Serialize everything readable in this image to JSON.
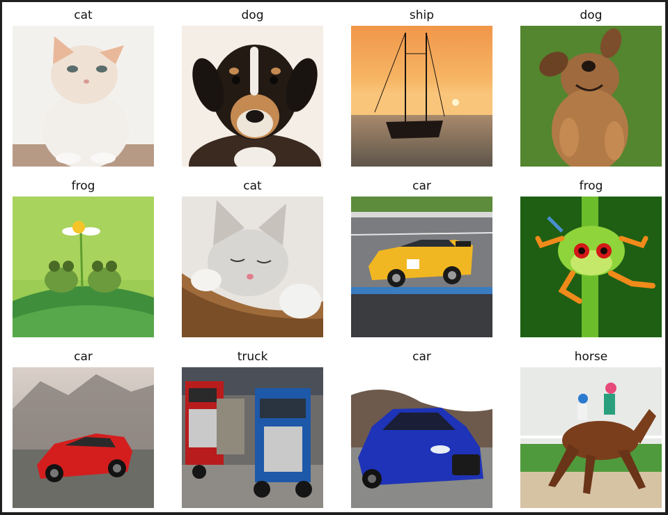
{
  "grid": {
    "cells": [
      {
        "label": "cat",
        "image": "white-kitten-photo"
      },
      {
        "label": "dog",
        "image": "puppy-face-photo"
      },
      {
        "label": "ship",
        "image": "sailing-ship-sunset-photo"
      },
      {
        "label": "dog",
        "image": "dog-lying-on-grass-photo"
      },
      {
        "label": "frog",
        "image": "two-frogs-under-flower-photo"
      },
      {
        "label": "cat",
        "image": "sleeping-kitten-photo"
      },
      {
        "label": "car",
        "image": "yellow-race-car-photo"
      },
      {
        "label": "frog",
        "image": "green-tree-frog-photo"
      },
      {
        "label": "car",
        "image": "red-sports-car-photo"
      },
      {
        "label": "truck",
        "image": "semi-trucks-expo-photo"
      },
      {
        "label": "car",
        "image": "blue-sedan-photo"
      },
      {
        "label": "horse",
        "image": "racing-horse-jockey-photo"
      }
    ]
  }
}
